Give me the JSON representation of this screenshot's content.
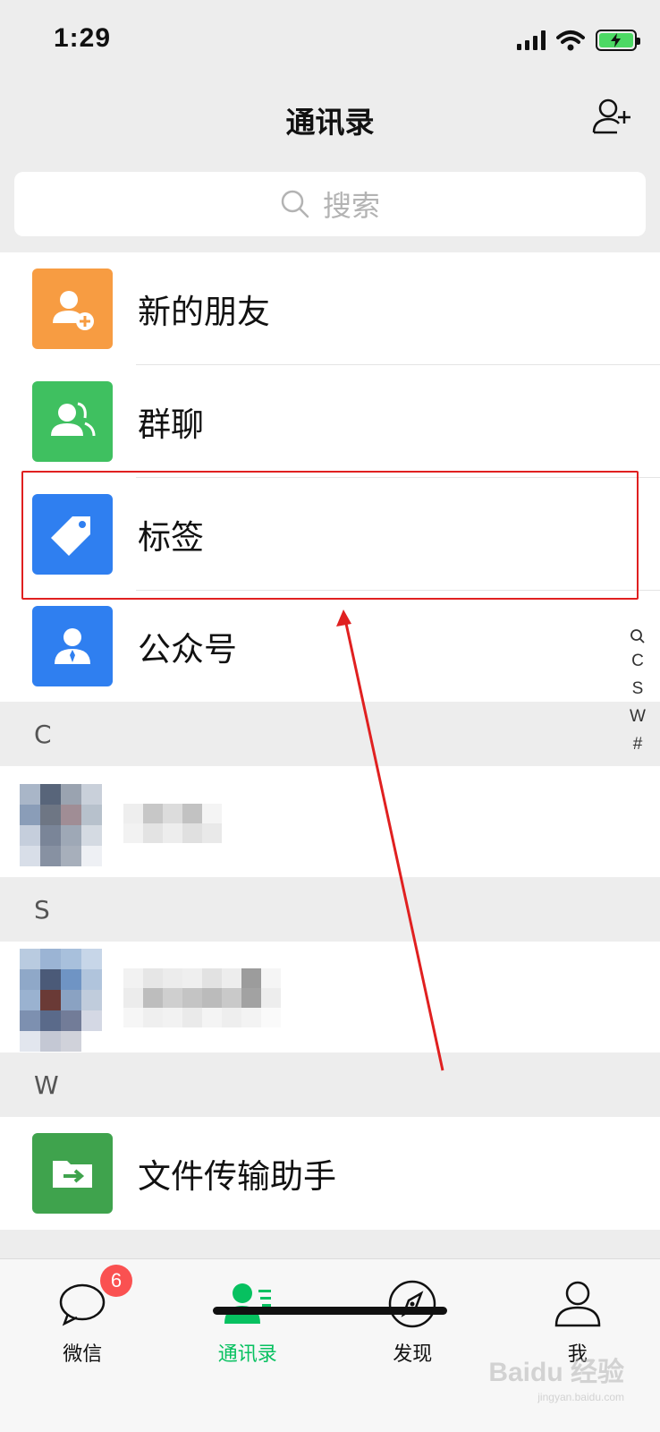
{
  "status_bar": {
    "time": "1:29"
  },
  "nav": {
    "title": "通讯录"
  },
  "search": {
    "placeholder": "搜索"
  },
  "top_items": [
    {
      "label": "新的朋友",
      "icon": "new-friend-icon",
      "color": "#f79c42"
    },
    {
      "label": "群聊",
      "icon": "group-chat-icon",
      "color": "#3fc060"
    },
    {
      "label": "标签",
      "icon": "tag-icon",
      "color": "#2f7ff0"
    },
    {
      "label": "公众号",
      "icon": "official-account-icon",
      "color": "#2f7ff0"
    }
  ],
  "sections": [
    {
      "letter": "C"
    },
    {
      "letter": "S"
    },
    {
      "letter": "W",
      "item": {
        "label": "文件传输助手",
        "icon": "file-transfer-icon",
        "color": "#3fa34d"
      }
    }
  ],
  "index_bar": [
    "C",
    "S",
    "W",
    "#"
  ],
  "tabs": [
    {
      "label": "微信",
      "badge": "6"
    },
    {
      "label": "通讯录"
    },
    {
      "label": "发现"
    },
    {
      "label": "我"
    }
  ],
  "colors": {
    "accent_green": "#07c160",
    "annotation_red": "#e02020",
    "badge_red": "#fa5151"
  }
}
